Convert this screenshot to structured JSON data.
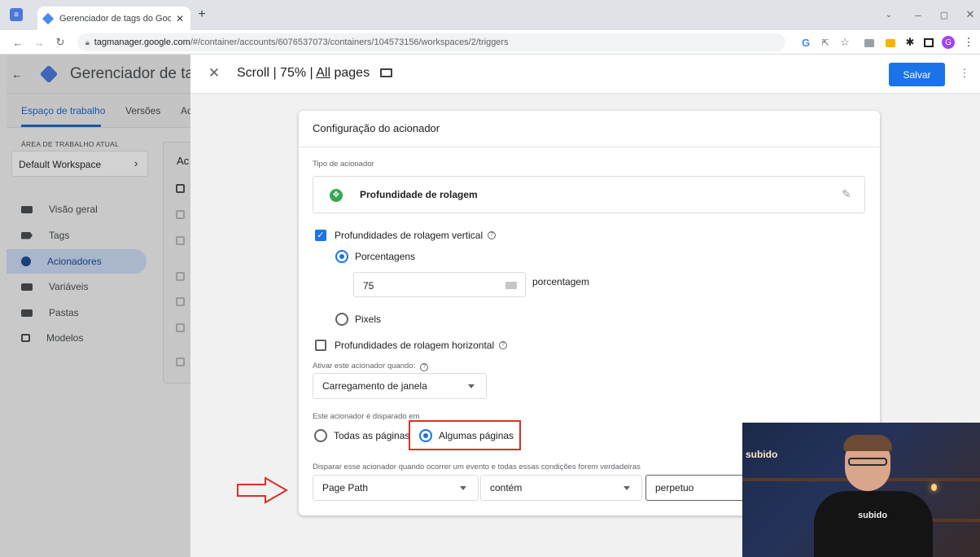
{
  "browser": {
    "tab_title": "Gerenciador de tags do Google",
    "url_host": "tagmanager.google.com",
    "url_path": "/#/container/accounts/6076537073/containers/104573156/workspaces/2/triggers",
    "profile_initial": "G"
  },
  "app": {
    "title": "Gerenciador de tags",
    "tabs": [
      "Espaço de trabalho",
      "Versões",
      "Ac"
    ],
    "workspace_label": "ÁREA DE TRABALHO ATUAL",
    "workspace_value": "Default Workspace",
    "nav": [
      {
        "label": "Visão geral",
        "icon": "briefcase-icon"
      },
      {
        "label": "Tags",
        "icon": "tag-icon"
      },
      {
        "label": "Acionadores",
        "icon": "trigger-icon"
      },
      {
        "label": "Variáveis",
        "icon": "variables-icon"
      },
      {
        "label": "Pastas",
        "icon": "folder-icon"
      },
      {
        "label": "Modelos",
        "icon": "template-icon"
      }
    ],
    "list_header": "Ac"
  },
  "editor": {
    "title_part1": "Scroll | 75% | ",
    "title_part2": "All",
    "title_part3": " pages",
    "save_label": "Salvar"
  },
  "card": {
    "title": "Configuração do acionador",
    "trigger_type_label": "Tipo de acionador",
    "trigger_type_value": "Profundidade de rolagem",
    "vertical_label": "Profundidades de rolagem vertical",
    "percentages_label": "Porcentagens",
    "percent_value": "75",
    "percent_unit": "porcentagem",
    "pixels_label": "Pixels",
    "horizontal_label": "Profundidades de rolagem horizontal",
    "enable_label": "Ativar este acionador quando:",
    "enable_value": "Carregamento de janela",
    "fires_on_label": "Este acionador é disparado em",
    "all_pages_label": "Todas as páginas",
    "some_pages_label": "Algumas páginas",
    "condition_label": "Disparar esse acionador quando ocorrer um evento e todas essas condições forem verdadeiras",
    "condition_variable": "Page Path",
    "condition_operator": "contém",
    "condition_value": "perpetuo"
  },
  "video": {
    "sign_text": "subido",
    "shirt_text": "subido"
  },
  "colors": {
    "accent": "#1a73e8",
    "highlight": "#d93025"
  }
}
